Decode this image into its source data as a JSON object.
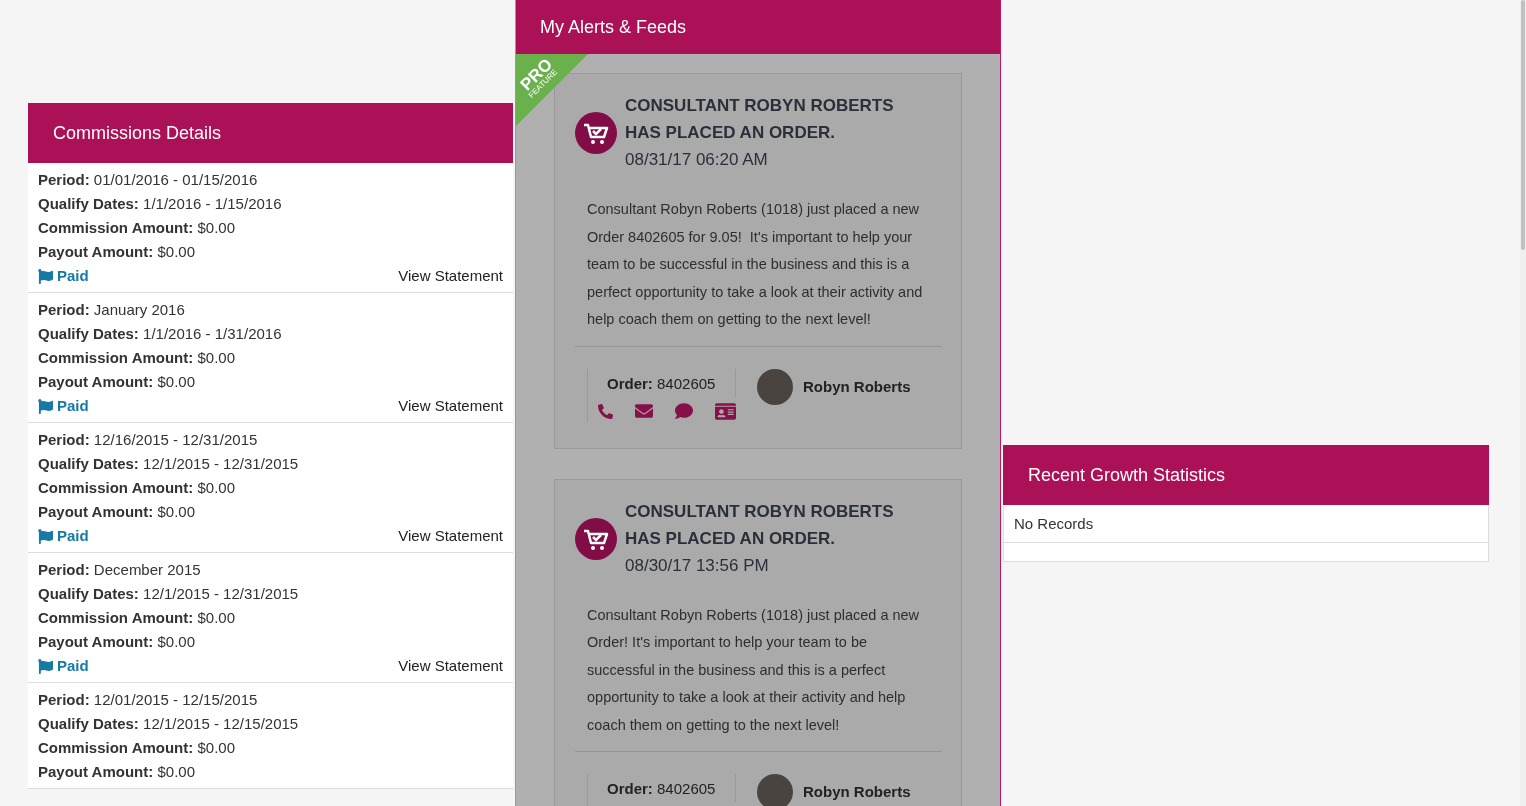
{
  "commissions": {
    "title": "Commissions Details",
    "records": [
      {
        "fields": [
          {
            "label": "Period:",
            "value": "01/01/2016 - 01/15/2016"
          },
          {
            "label": "Qualify Dates:",
            "value": "1/1/2016 - 1/15/2016"
          },
          {
            "label": "Commission Amount:",
            "value": "$0.00"
          },
          {
            "label": "Payout Amount:",
            "value": "$0.00"
          }
        ],
        "status": "Paid",
        "link": "View Statement"
      },
      {
        "fields": [
          {
            "label": "Period:",
            "value": "January 2016"
          },
          {
            "label": "Qualify Dates:",
            "value": "1/1/2016 - 1/31/2016"
          },
          {
            "label": "Commission Amount:",
            "value": "$0.00"
          },
          {
            "label": "Payout Amount:",
            "value": "$0.00"
          }
        ],
        "status": "Paid",
        "link": "View Statement"
      },
      {
        "fields": [
          {
            "label": "Period:",
            "value": "12/16/2015 - 12/31/2015"
          },
          {
            "label": "Qualify Dates:",
            "value": "12/1/2015 - 12/31/2015"
          },
          {
            "label": "Commission Amount:",
            "value": "$0.00"
          },
          {
            "label": "Payout Amount:",
            "value": "$0.00"
          }
        ],
        "status": "Paid",
        "link": "View Statement"
      },
      {
        "fields": [
          {
            "label": "Period:",
            "value": "December 2015"
          },
          {
            "label": "Qualify Dates:",
            "value": "12/1/2015 - 12/31/2015"
          },
          {
            "label": "Commission Amount:",
            "value": "$0.00"
          },
          {
            "label": "Payout Amount:",
            "value": "$0.00"
          }
        ],
        "status": "Paid",
        "link": "View Statement"
      },
      {
        "fields": [
          {
            "label": "Period:",
            "value": "12/01/2015 - 12/15/2015"
          },
          {
            "label": "Qualify Dates:",
            "value": "12/1/2015 - 12/15/2015"
          },
          {
            "label": "Commission Amount:",
            "value": "$0.00"
          },
          {
            "label": "Payout Amount:",
            "value": "$0.00"
          }
        ]
      }
    ]
  },
  "alerts": {
    "title": "My Alerts & Feeds",
    "ribbon": {
      "top": "PRO",
      "bottom": "FEATURE"
    },
    "feeds": [
      {
        "title": "CONSULTANT ROBYN ROBERTS HAS PLACED AN ORDER.",
        "time": "08/31/17 06:20 AM",
        "body": "Consultant Robyn Roberts (1018) just placed a new Order 8402605 for 9.05!  It's important to help your team to be successful in the business and this is a perfect opportunity to take a look at their activity and help coach them on getting to the next level!",
        "order_label": "Order:",
        "order_number": "8402605",
        "name": "Robyn Roberts"
      },
      {
        "title": "CONSULTANT ROBYN ROBERTS HAS PLACED AN ORDER.",
        "time": "08/30/17 13:56 PM",
        "body": "Consultant Robyn Roberts (1018) just placed a new Order! It's important to help your team to be successful in the business and this is a perfect opportunity to take a look at their activity and help coach them on getting to the next level!",
        "order_label": "Order:",
        "order_number": "8402605",
        "name": "Robyn Roberts"
      }
    ]
  },
  "growth": {
    "title": "Recent Growth Statistics",
    "empty": "No Records"
  }
}
